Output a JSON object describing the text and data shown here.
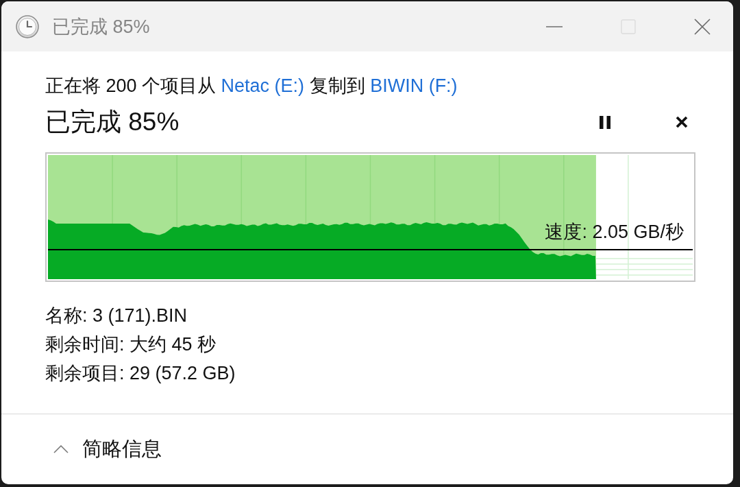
{
  "window": {
    "title": "已完成 85%",
    "controls": [
      {
        "kind": "minimize",
        "disabled": false
      },
      {
        "kind": "maximize",
        "disabled": true
      },
      {
        "kind": "close",
        "disabled": false
      }
    ]
  },
  "description": [
    {
      "kind": "text",
      "text": "正在将 200 个项目从"
    },
    {
      "kind": "link",
      "text": "Netac (E:)"
    },
    {
      "kind": "text",
      "text": "复制到"
    },
    {
      "kind": "link",
      "text": "BIWIN (F:)"
    }
  ],
  "progress": {
    "heading": "已完成 85%",
    "buttons": [
      {
        "kind": "pause"
      },
      {
        "kind": "cancel"
      }
    ]
  },
  "graph": {
    "level": 0.85,
    "speed_label": "速度: 2.05 GB/秒"
  },
  "details": [
    "名称: 3 (171).BIN",
    "剩余时间: 大约 45 秒",
    "剩余项目: 29 (57.2 GB)"
  ],
  "details_toggle": {
    "label": "简略信息",
    "expanded": true
  }
}
